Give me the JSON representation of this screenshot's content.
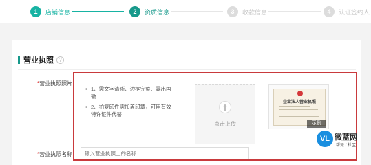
{
  "steps": [
    {
      "num": "1",
      "label": "店铺信息"
    },
    {
      "num": "2",
      "label": "资质信息"
    },
    {
      "num": "3",
      "label": "收款信息"
    },
    {
      "num": "4",
      "label": "认证签约人"
    }
  ],
  "section": {
    "title": "营业执照",
    "help": "?"
  },
  "photo_field": {
    "required_mark": "*",
    "label": "营业执照照片",
    "tips": [
      "1、需文字清晰、边框完整、露出国徽",
      "2、拍复印件需加盖印章，可用有效特许证件代替"
    ],
    "upload_text": "点击上传",
    "sample_doc_title": "企业法人营业执照",
    "sample_tag": "示例"
  },
  "name_field": {
    "required_mark": "*",
    "label": "营业执照名称",
    "placeholder": "输入营业执照上的名称"
  },
  "watermark": {
    "mark": "VL",
    "name": "微蓝网",
    "sub": "帮派 / 社区"
  },
  "colors": {
    "accent": "#17b3a3",
    "highlight": "#c93a3d",
    "required": "#e23c3c"
  }
}
